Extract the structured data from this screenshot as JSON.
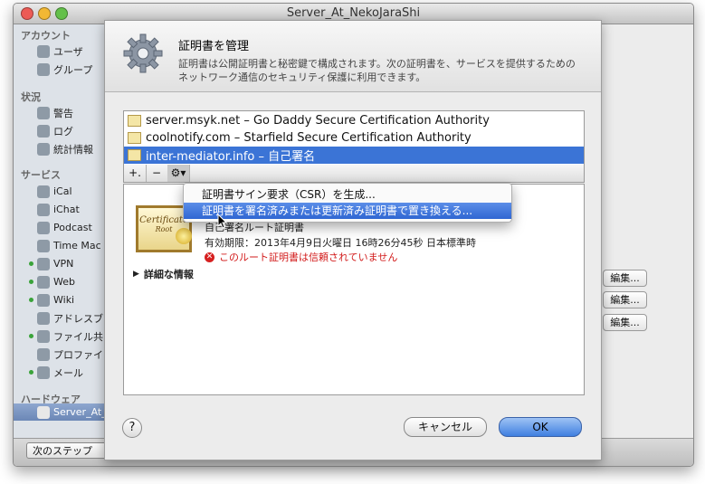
{
  "window": {
    "title": "Server_At_NekoJaraShi",
    "traffic_colors": [
      "#ec5b55",
      "#f2b834",
      "#64c04a"
    ]
  },
  "sidebar": {
    "sections": [
      {
        "label": "アカウント",
        "items": [
          {
            "label": "ユーザ",
            "icon": "user-icon"
          },
          {
            "label": "グループ",
            "icon": "group-icon"
          }
        ]
      },
      {
        "label": "状況",
        "items": [
          {
            "label": "警告",
            "icon": "alert-icon"
          },
          {
            "label": "ログ",
            "icon": "log-icon"
          },
          {
            "label": "統計情報",
            "icon": "stats-icon"
          }
        ]
      },
      {
        "label": "サービス",
        "items": [
          {
            "label": "iCal",
            "icon": "calendar-icon",
            "status": false
          },
          {
            "label": "iChat",
            "icon": "chat-icon",
            "status": false
          },
          {
            "label": "Podcast",
            "icon": "podcast-icon",
            "status": false
          },
          {
            "label": "Time Mac",
            "icon": "time-machine-icon",
            "status": false
          },
          {
            "label": "VPN",
            "icon": "vpn-icon",
            "status": true
          },
          {
            "label": "Web",
            "icon": "web-icon",
            "status": true
          },
          {
            "label": "Wiki",
            "icon": "wiki-icon",
            "status": true
          },
          {
            "label": "アドレスブ",
            "icon": "address-book-icon",
            "status": false
          },
          {
            "label": "ファイル共",
            "icon": "file-sharing-icon",
            "status": true
          },
          {
            "label": "プロファイ",
            "icon": "profile-icon",
            "status": false
          },
          {
            "label": "メール",
            "icon": "mail-icon",
            "status": true
          }
        ]
      },
      {
        "label": "ハードウェア",
        "items": [
          {
            "label": "Server_At_",
            "icon": "server-icon",
            "selected": true
          }
        ]
      }
    ]
  },
  "bottom": {
    "next_step_label": "次のステップ"
  },
  "background": {
    "edit_buttons": [
      "編集...",
      "編集...",
      "編集..."
    ]
  },
  "sheet": {
    "title": "証明書を管理",
    "description": "証明書は公開証明書と秘密鍵で構成されます。次の証明書を、サービスを提供するためのネットワーク通信のセキュリティ保護に利用できます。",
    "certificates": [
      {
        "label": "server.msyk.net – Go Daddy Secure Certification Authority",
        "selected": false
      },
      {
        "label": "coolnotify.com – Starfield Secure Certification Authority",
        "selected": false
      },
      {
        "label": "inter-mediator.info – 自己署名",
        "selected": true
      }
    ],
    "toolbar": {
      "add": "+.",
      "remove": "−",
      "action": "⚙▾"
    },
    "detail": {
      "cert_image_text": "Certificate",
      "cert_image_sub": "Root",
      "type": "自己署名ルート証明書",
      "expiry": "有効期限：2013年4月9日火曜日 16時26分45秒 日本標準時",
      "warning": "このルート証明書は信頼されていません",
      "details_label": "詳細な情報"
    },
    "help_label": "?",
    "cancel_label": "キャンセル",
    "ok_label": "OK"
  },
  "context_menu": {
    "items": [
      "証明書サイン要求（CSR）を生成...",
      "証明書を署名済みまたは更新済み証明書で置き換える..."
    ],
    "highlighted_index": 1
  },
  "colors": {
    "selection": "#3b74d6",
    "warning": "#d21b1b",
    "ok_button": "#3f7fe0"
  }
}
